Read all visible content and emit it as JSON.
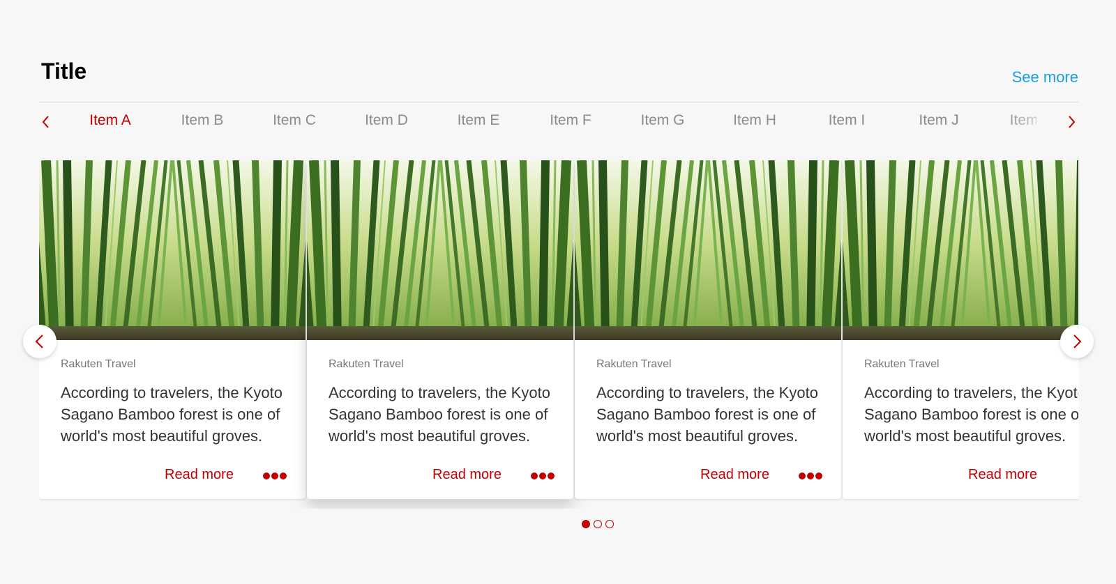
{
  "section": {
    "title": "Title",
    "see_more_label": "See more"
  },
  "tabs": [
    {
      "label": "Item A",
      "active": true
    },
    {
      "label": "Item B",
      "active": false
    },
    {
      "label": "Item C",
      "active": false
    },
    {
      "label": "Item D",
      "active": false
    },
    {
      "label": "Item E",
      "active": false
    },
    {
      "label": "Item F",
      "active": false
    },
    {
      "label": "Item G",
      "active": false
    },
    {
      "label": "Item H",
      "active": false
    },
    {
      "label": "Item I",
      "active": false
    },
    {
      "label": "Item J",
      "active": false
    },
    {
      "label": "Item K",
      "active": false
    }
  ],
  "cards": [
    {
      "source": "Rakuten Travel",
      "description": "According to travelers, the Kyoto Sagano Bamboo forest is one of world's most beautiful groves.",
      "read_more_label": "Read more",
      "image_icon": "bamboo-forest-image"
    },
    {
      "source": "Rakuten Travel",
      "description": "According to travelers, the Kyoto Sagano Bamboo forest is one of world's most beautiful groves.",
      "read_more_label": "Read more",
      "image_icon": "bamboo-forest-image"
    },
    {
      "source": "Rakuten Travel",
      "description": "According to travelers, the Kyoto Sagano Bamboo forest is one of world's most beautiful groves.",
      "read_more_label": "Read more",
      "image_icon": "bamboo-forest-image"
    },
    {
      "source": "Rakuten Travel",
      "description": "According to travelers, the Kyoto Sagano Bamboo forest is one of world's most beautiful groves.",
      "read_more_label": "Read more",
      "image_icon": "bamboo-forest-image"
    }
  ],
  "pagination": {
    "pages": 3,
    "current": 1
  },
  "colors": {
    "accent": "#bf0000",
    "link": "#1a9ee6",
    "background": "#f7f7f7"
  },
  "icons": {
    "tab_prev": "chevron-left-icon",
    "tab_next": "chevron-right-icon",
    "carousel_prev": "chevron-left-icon",
    "carousel_next": "chevron-right-icon",
    "card_menu": "more-dots-icon"
  }
}
